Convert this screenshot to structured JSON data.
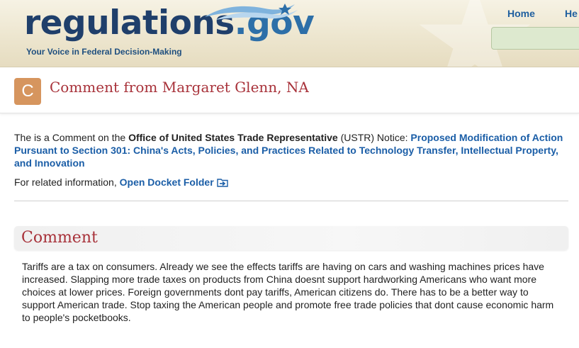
{
  "header": {
    "logo_main": "regulations",
    "logo_domain": ".gov",
    "tagline": "Your Voice in Federal Decision-Making",
    "nav": {
      "home": "Home",
      "help": "He"
    },
    "search": {
      "value": ""
    }
  },
  "title": {
    "badge_letter": "C",
    "text": "Comment from Margaret Glenn, NA"
  },
  "info": {
    "prefix": "The is a Comment on the ",
    "agency": "Office of United States Trade Representative",
    "agency_abbr_text": " (USTR) Notice: ",
    "notice_link": "Proposed Modification of Action Pursuant to Section 301: China's Acts, Policies, and Practices Related to Technology Transfer, Intellectual Property, and Innovation"
  },
  "related": {
    "prefix": "For related information, ",
    "link": "Open Docket Folder"
  },
  "comment_section": {
    "heading": "Comment",
    "body": "Tariffs are a tax on consumers. Already we see the effects tariffs are having on cars and washing machines prices have increased. Slapping more trade taxes on products from China doesnt support hardworking Americans who want more choices at lower prices. Foreign governments dont pay tariffs, American citizens do. There has to be a better way to support American trade. Stop taxing the American people and promote free trade policies that dont cause economic harm to people's pocketbooks."
  },
  "colors": {
    "title_red": "#a8323a",
    "link_blue": "#1b5ea7",
    "badge_orange": "#d6955e",
    "logo_navy": "#1f3f6b"
  },
  "icons": {
    "folder": "folder-arrow-icon",
    "header_star": "star-watermark-icon",
    "logo_swoosh": "flag-swoosh-icon"
  }
}
